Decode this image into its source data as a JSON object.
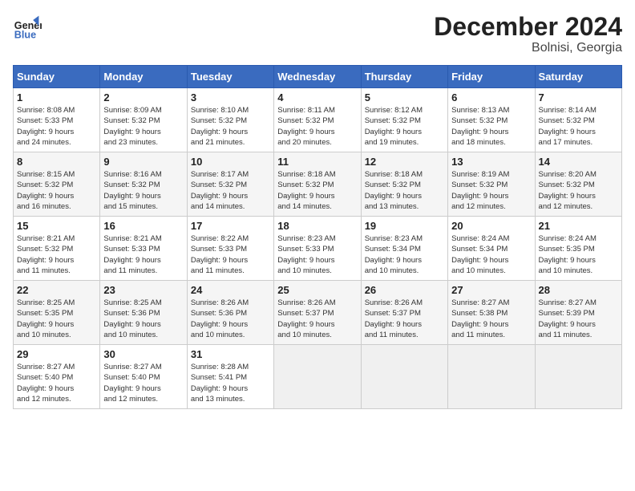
{
  "header": {
    "logo_line1": "General",
    "logo_line2": "Blue",
    "title": "December 2024",
    "subtitle": "Bolnisi, Georgia"
  },
  "columns": [
    "Sunday",
    "Monday",
    "Tuesday",
    "Wednesday",
    "Thursday",
    "Friday",
    "Saturday"
  ],
  "weeks": [
    [
      {
        "day": "1",
        "info": "Sunrise: 8:08 AM\nSunset: 5:33 PM\nDaylight: 9 hours\nand 24 minutes."
      },
      {
        "day": "2",
        "info": "Sunrise: 8:09 AM\nSunset: 5:32 PM\nDaylight: 9 hours\nand 23 minutes."
      },
      {
        "day": "3",
        "info": "Sunrise: 8:10 AM\nSunset: 5:32 PM\nDaylight: 9 hours\nand 21 minutes."
      },
      {
        "day": "4",
        "info": "Sunrise: 8:11 AM\nSunset: 5:32 PM\nDaylight: 9 hours\nand 20 minutes."
      },
      {
        "day": "5",
        "info": "Sunrise: 8:12 AM\nSunset: 5:32 PM\nDaylight: 9 hours\nand 19 minutes."
      },
      {
        "day": "6",
        "info": "Sunrise: 8:13 AM\nSunset: 5:32 PM\nDaylight: 9 hours\nand 18 minutes."
      },
      {
        "day": "7",
        "info": "Sunrise: 8:14 AM\nSunset: 5:32 PM\nDaylight: 9 hours\nand 17 minutes."
      }
    ],
    [
      {
        "day": "8",
        "info": "Sunrise: 8:15 AM\nSunset: 5:32 PM\nDaylight: 9 hours\nand 16 minutes."
      },
      {
        "day": "9",
        "info": "Sunrise: 8:16 AM\nSunset: 5:32 PM\nDaylight: 9 hours\nand 15 minutes."
      },
      {
        "day": "10",
        "info": "Sunrise: 8:17 AM\nSunset: 5:32 PM\nDaylight: 9 hours\nand 14 minutes."
      },
      {
        "day": "11",
        "info": "Sunrise: 8:18 AM\nSunset: 5:32 PM\nDaylight: 9 hours\nand 14 minutes."
      },
      {
        "day": "12",
        "info": "Sunrise: 8:18 AM\nSunset: 5:32 PM\nDaylight: 9 hours\nand 13 minutes."
      },
      {
        "day": "13",
        "info": "Sunrise: 8:19 AM\nSunset: 5:32 PM\nDaylight: 9 hours\nand 12 minutes."
      },
      {
        "day": "14",
        "info": "Sunrise: 8:20 AM\nSunset: 5:32 PM\nDaylight: 9 hours\nand 12 minutes."
      }
    ],
    [
      {
        "day": "15",
        "info": "Sunrise: 8:21 AM\nSunset: 5:32 PM\nDaylight: 9 hours\nand 11 minutes."
      },
      {
        "day": "16",
        "info": "Sunrise: 8:21 AM\nSunset: 5:33 PM\nDaylight: 9 hours\nand 11 minutes."
      },
      {
        "day": "17",
        "info": "Sunrise: 8:22 AM\nSunset: 5:33 PM\nDaylight: 9 hours\nand 11 minutes."
      },
      {
        "day": "18",
        "info": "Sunrise: 8:23 AM\nSunset: 5:33 PM\nDaylight: 9 hours\nand 10 minutes."
      },
      {
        "day": "19",
        "info": "Sunrise: 8:23 AM\nSunset: 5:34 PM\nDaylight: 9 hours\nand 10 minutes."
      },
      {
        "day": "20",
        "info": "Sunrise: 8:24 AM\nSunset: 5:34 PM\nDaylight: 9 hours\nand 10 minutes."
      },
      {
        "day": "21",
        "info": "Sunrise: 8:24 AM\nSunset: 5:35 PM\nDaylight: 9 hours\nand 10 minutes."
      }
    ],
    [
      {
        "day": "22",
        "info": "Sunrise: 8:25 AM\nSunset: 5:35 PM\nDaylight: 9 hours\nand 10 minutes."
      },
      {
        "day": "23",
        "info": "Sunrise: 8:25 AM\nSunset: 5:36 PM\nDaylight: 9 hours\nand 10 minutes."
      },
      {
        "day": "24",
        "info": "Sunrise: 8:26 AM\nSunset: 5:36 PM\nDaylight: 9 hours\nand 10 minutes."
      },
      {
        "day": "25",
        "info": "Sunrise: 8:26 AM\nSunset: 5:37 PM\nDaylight: 9 hours\nand 10 minutes."
      },
      {
        "day": "26",
        "info": "Sunrise: 8:26 AM\nSunset: 5:37 PM\nDaylight: 9 hours\nand 11 minutes."
      },
      {
        "day": "27",
        "info": "Sunrise: 8:27 AM\nSunset: 5:38 PM\nDaylight: 9 hours\nand 11 minutes."
      },
      {
        "day": "28",
        "info": "Sunrise: 8:27 AM\nSunset: 5:39 PM\nDaylight: 9 hours\nand 11 minutes."
      }
    ],
    [
      {
        "day": "29",
        "info": "Sunrise: 8:27 AM\nSunset: 5:40 PM\nDaylight: 9 hours\nand 12 minutes."
      },
      {
        "day": "30",
        "info": "Sunrise: 8:27 AM\nSunset: 5:40 PM\nDaylight: 9 hours\nand 12 minutes."
      },
      {
        "day": "31",
        "info": "Sunrise: 8:28 AM\nSunset: 5:41 PM\nDaylight: 9 hours\nand 13 minutes."
      },
      null,
      null,
      null,
      null
    ]
  ]
}
